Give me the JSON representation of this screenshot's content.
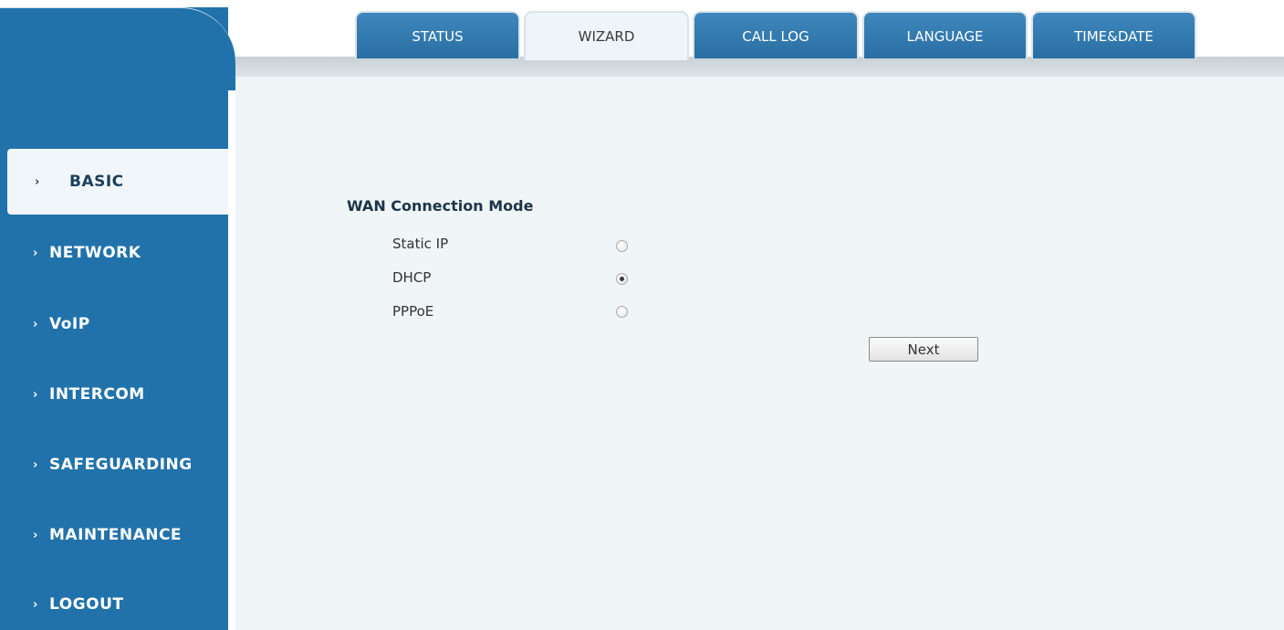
{
  "tabs": [
    {
      "label": "STATUS",
      "active": false
    },
    {
      "label": "WIZARD",
      "active": true
    },
    {
      "label": "CALL LOG",
      "active": false
    },
    {
      "label": "LANGUAGE",
      "active": false
    },
    {
      "label": "TIME&DATE",
      "active": false
    }
  ],
  "sidebar": {
    "items": [
      {
        "label": "BASIC",
        "active": true
      },
      {
        "label": "NETWORK",
        "active": false
      },
      {
        "label": "VoIP",
        "active": false
      },
      {
        "label": "INTERCOM",
        "active": false
      },
      {
        "label": "SAFEGUARDING",
        "active": false
      },
      {
        "label": "MAINTENANCE",
        "active": false
      },
      {
        "label": "LOGOUT",
        "active": false
      }
    ]
  },
  "wan": {
    "title": "WAN Connection Mode",
    "options": [
      {
        "label": "Static IP",
        "selected": false
      },
      {
        "label": "DHCP",
        "selected": true
      },
      {
        "label": "PPPoE",
        "selected": false
      }
    ]
  },
  "buttons": {
    "next_label": "Next"
  },
  "colors": {
    "sidebar": "#2172aa",
    "tab": "#2f77ac",
    "content_bg": "#f0f5f8"
  },
  "icons": {
    "chevron": "chevron-right-icon"
  }
}
